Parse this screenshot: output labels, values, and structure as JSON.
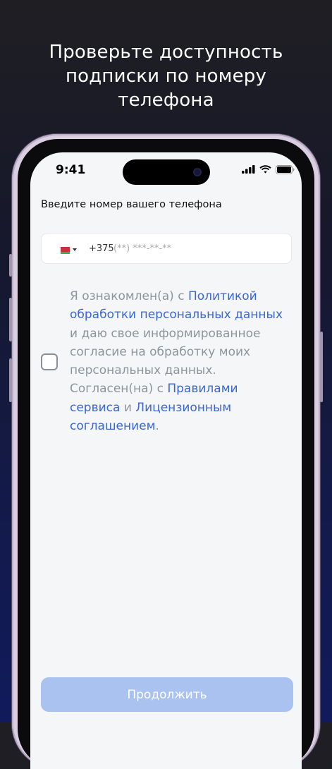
{
  "promo": {
    "title_line1": "Проверьте доступность",
    "title_line2": "подписки по номеру",
    "title_line3": "телефона"
  },
  "status_bar": {
    "time": "9:41",
    "icons": [
      "cellular-signal-icon",
      "wifi-icon",
      "battery-icon"
    ]
  },
  "form": {
    "label": "Введите номер вашего телефона",
    "phone": {
      "country_flag": "belarus-flag-icon",
      "prefix": "+375",
      "placeholder": "(**) ***-**-**"
    },
    "consent": {
      "checked": false,
      "t1": "Я ознакомлен(а) с ",
      "link1": "Политикой обработки персональных данных",
      "t2": " и даю свое информированное согласие на обработку моих персональных данных. Согласен(на) с ",
      "link2": "Правилами сервиса",
      "t3": " и ",
      "link3": "Лицензионным соглашением",
      "t4": "."
    },
    "submit_label": "Продолжить"
  },
  "colors": {
    "link": "#3a67d6",
    "button_disabled": "#a9c2f0",
    "background_dark": "#131a4a"
  }
}
